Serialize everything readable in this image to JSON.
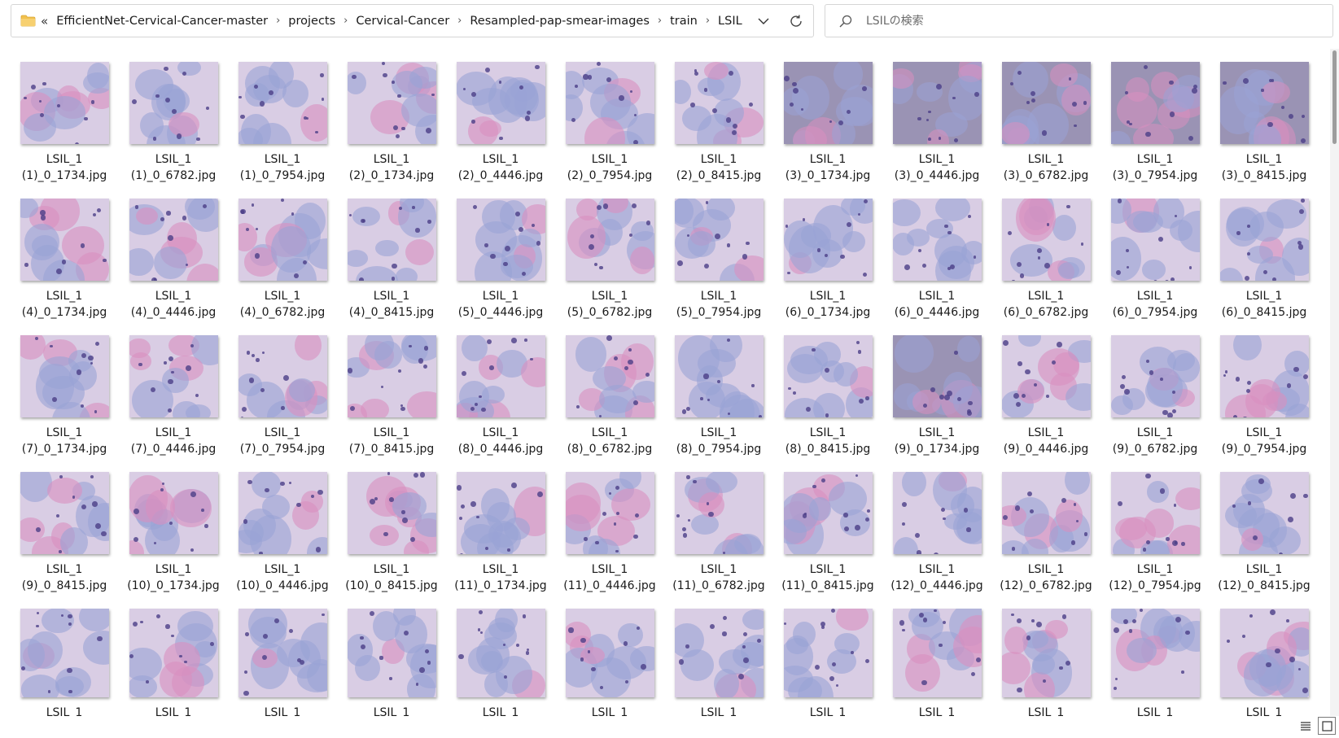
{
  "address_bar": {
    "overflow": "«",
    "breadcrumbs": [
      "EfficientNet-Cervical-Cancer-master",
      "projects",
      "Cervical-Cancer",
      "Resampled-pap-smear-images",
      "train",
      "LSIL"
    ]
  },
  "search": {
    "placeholder": "LSILの検索"
  },
  "files": [
    {
      "line1": "LSIL_1",
      "line2": "(1)_0_1734.jpg",
      "icon": "pap-smear-thumbnail"
    },
    {
      "line1": "LSIL_1",
      "line2": "(1)_0_6782.jpg",
      "icon": "pap-smear-thumbnail"
    },
    {
      "line1": "LSIL_1",
      "line2": "(1)_0_7954.jpg",
      "icon": "pap-smear-thumbnail"
    },
    {
      "line1": "LSIL_1",
      "line2": "(2)_0_1734.jpg",
      "icon": "pap-smear-thumbnail"
    },
    {
      "line1": "LSIL_1",
      "line2": "(2)_0_4446.jpg",
      "icon": "pap-smear-thumbnail"
    },
    {
      "line1": "LSIL_1",
      "line2": "(2)_0_7954.jpg",
      "icon": "pap-smear-thumbnail"
    },
    {
      "line1": "LSIL_1",
      "line2": "(2)_0_8415.jpg",
      "icon": "pap-smear-thumbnail"
    },
    {
      "line1": "LSIL_1",
      "line2": "(3)_0_1734.jpg",
      "icon": "pap-smear-thumbnail"
    },
    {
      "line1": "LSIL_1",
      "line2": "(3)_0_4446.jpg",
      "icon": "pap-smear-thumbnail"
    },
    {
      "line1": "LSIL_1",
      "line2": "(3)_0_6782.jpg",
      "icon": "pap-smear-thumbnail"
    },
    {
      "line1": "LSIL_1",
      "line2": "(3)_0_7954.jpg",
      "icon": "pap-smear-thumbnail"
    },
    {
      "line1": "LSIL_1",
      "line2": "(3)_0_8415.jpg",
      "icon": "pap-smear-thumbnail"
    },
    {
      "line1": "LSIL_1",
      "line2": "(4)_0_1734.jpg",
      "icon": "pap-smear-thumbnail"
    },
    {
      "line1": "LSIL_1",
      "line2": "(4)_0_4446.jpg",
      "icon": "pap-smear-thumbnail"
    },
    {
      "line1": "LSIL_1",
      "line2": "(4)_0_6782.jpg",
      "icon": "pap-smear-thumbnail"
    },
    {
      "line1": "LSIL_1",
      "line2": "(4)_0_8415.jpg",
      "icon": "pap-smear-thumbnail"
    },
    {
      "line1": "LSIL_1",
      "line2": "(5)_0_4446.jpg",
      "icon": "pap-smear-thumbnail"
    },
    {
      "line1": "LSIL_1",
      "line2": "(5)_0_6782.jpg",
      "icon": "pap-smear-thumbnail"
    },
    {
      "line1": "LSIL_1",
      "line2": "(5)_0_7954.jpg",
      "icon": "pap-smear-thumbnail"
    },
    {
      "line1": "LSIL_1",
      "line2": "(6)_0_1734.jpg",
      "icon": "pap-smear-thumbnail"
    },
    {
      "line1": "LSIL_1",
      "line2": "(6)_0_4446.jpg",
      "icon": "pap-smear-thumbnail"
    },
    {
      "line1": "LSIL_1",
      "line2": "(6)_0_6782.jpg",
      "icon": "pap-smear-thumbnail"
    },
    {
      "line1": "LSIL_1",
      "line2": "(6)_0_7954.jpg",
      "icon": "pap-smear-thumbnail"
    },
    {
      "line1": "LSIL_1",
      "line2": "(6)_0_8415.jpg",
      "icon": "pap-smear-thumbnail"
    },
    {
      "line1": "LSIL_1",
      "line2": "(7)_0_1734.jpg",
      "icon": "pap-smear-thumbnail"
    },
    {
      "line1": "LSIL_1",
      "line2": "(7)_0_4446.jpg",
      "icon": "pap-smear-thumbnail"
    },
    {
      "line1": "LSIL_1",
      "line2": "(7)_0_7954.jpg",
      "icon": "pap-smear-thumbnail"
    },
    {
      "line1": "LSIL_1",
      "line2": "(7)_0_8415.jpg",
      "icon": "pap-smear-thumbnail"
    },
    {
      "line1": "LSIL_1",
      "line2": "(8)_0_4446.jpg",
      "icon": "pap-smear-thumbnail"
    },
    {
      "line1": "LSIL_1",
      "line2": "(8)_0_6782.jpg",
      "icon": "pap-smear-thumbnail"
    },
    {
      "line1": "LSIL_1",
      "line2": "(8)_0_7954.jpg",
      "icon": "pap-smear-thumbnail"
    },
    {
      "line1": "LSIL_1",
      "line2": "(8)_0_8415.jpg",
      "icon": "pap-smear-thumbnail"
    },
    {
      "line1": "LSIL_1",
      "line2": "(9)_0_1734.jpg",
      "icon": "pap-smear-thumbnail"
    },
    {
      "line1": "LSIL_1",
      "line2": "(9)_0_4446.jpg",
      "icon": "pap-smear-thumbnail"
    },
    {
      "line1": "LSIL_1",
      "line2": "(9)_0_6782.jpg",
      "icon": "pap-smear-thumbnail"
    },
    {
      "line1": "LSIL_1",
      "line2": "(9)_0_7954.jpg",
      "icon": "pap-smear-thumbnail"
    },
    {
      "line1": "LSIL_1",
      "line2": "(9)_0_8415.jpg",
      "icon": "pap-smear-thumbnail"
    },
    {
      "line1": "LSIL_1",
      "line2": "(10)_0_1734.jpg",
      "icon": "pap-smear-thumbnail"
    },
    {
      "line1": "LSIL_1",
      "line2": "(10)_0_4446.jpg",
      "icon": "pap-smear-thumbnail"
    },
    {
      "line1": "LSIL_1",
      "line2": "(10)_0_8415.jpg",
      "icon": "pap-smear-thumbnail"
    },
    {
      "line1": "LSIL_1",
      "line2": "(11)_0_1734.jpg",
      "icon": "pap-smear-thumbnail"
    },
    {
      "line1": "LSIL_1",
      "line2": "(11)_0_4446.jpg",
      "icon": "pap-smear-thumbnail"
    },
    {
      "line1": "LSIL_1",
      "line2": "(11)_0_6782.jpg",
      "icon": "pap-smear-thumbnail"
    },
    {
      "line1": "LSIL_1",
      "line2": "(11)_0_8415.jpg",
      "icon": "pap-smear-thumbnail"
    },
    {
      "line1": "LSIL_1",
      "line2": "(12)_0_4446.jpg",
      "icon": "pap-smear-thumbnail"
    },
    {
      "line1": "LSIL_1",
      "line2": "(12)_0_6782.jpg",
      "icon": "pap-smear-thumbnail"
    },
    {
      "line1": "LSIL_1",
      "line2": "(12)_0_7954.jpg",
      "icon": "pap-smear-thumbnail"
    },
    {
      "line1": "LSIL_1",
      "line2": "(12)_0_8415.jpg",
      "icon": "pap-smear-thumbnail"
    },
    {
      "line1": "LSIL_1",
      "line2": "",
      "icon": "pap-smear-thumbnail"
    },
    {
      "line1": "LSIL_1",
      "line2": "",
      "icon": "pap-smear-thumbnail"
    },
    {
      "line1": "LSIL_1",
      "line2": "",
      "icon": "pap-smear-thumbnail"
    },
    {
      "line1": "LSIL_1",
      "line2": "",
      "icon": "pap-smear-thumbnail"
    },
    {
      "line1": "LSIL_1",
      "line2": "",
      "icon": "pap-smear-thumbnail"
    },
    {
      "line1": "LSIL_1",
      "line2": "",
      "icon": "pap-smear-thumbnail"
    },
    {
      "line1": "LSIL_1",
      "line2": "",
      "icon": "pap-smear-thumbnail"
    },
    {
      "line1": "LSIL_1",
      "line2": "",
      "icon": "pap-smear-thumbnail"
    },
    {
      "line1": "LSIL_1",
      "line2": "",
      "icon": "pap-smear-thumbnail"
    },
    {
      "line1": "LSIL_1",
      "line2": "",
      "icon": "pap-smear-thumbnail"
    },
    {
      "line1": "LSIL_1",
      "line2": "",
      "icon": "pap-smear-thumbnail"
    },
    {
      "line1": "LSIL_1",
      "line2": "",
      "icon": "pap-smear-thumbnail"
    }
  ],
  "view_toggles": [
    {
      "name": "details-view-icon",
      "active": false
    },
    {
      "name": "large-icons-view-icon",
      "active": true
    }
  ],
  "colors": {
    "folder": "#f2c14e",
    "thumb_bg": "#d9cde4",
    "cell_blue": "#9aa3d6",
    "cell_pink": "#d98fc0",
    "nucleus": "#4b3f87"
  }
}
